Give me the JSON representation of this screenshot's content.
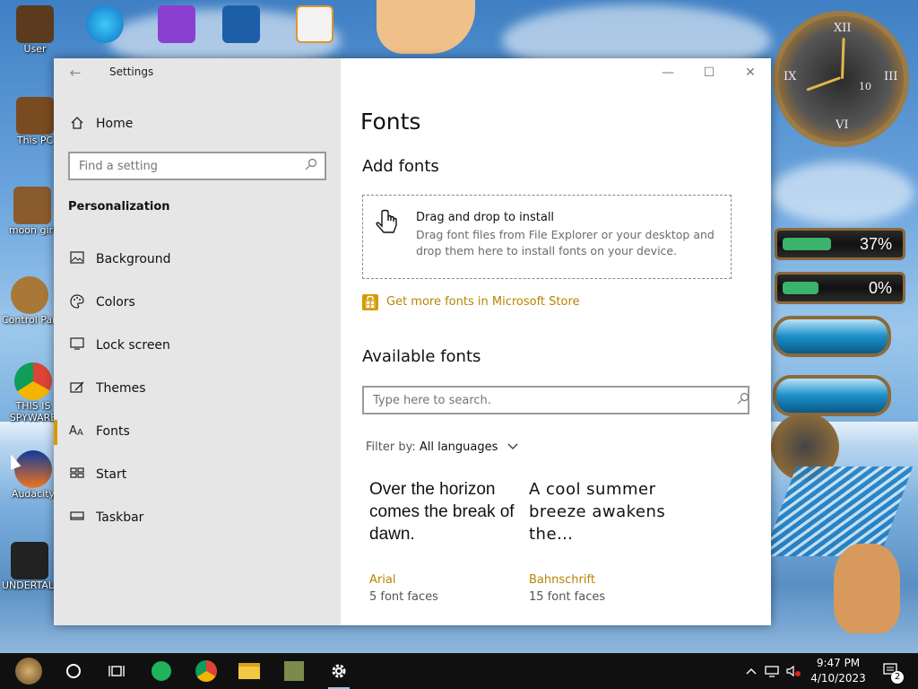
{
  "desktop": {
    "icons": [
      {
        "label": "User"
      },
      {
        "label": "This PC"
      },
      {
        "label": "moon girl"
      },
      {
        "label": "Control Panel"
      },
      {
        "label": "THIS IS"
      },
      {
        "label": "SPYWARE"
      },
      {
        "label": "Audacity"
      },
      {
        "label": "UNDERTALE"
      }
    ],
    "widgets": {
      "gauge_top": "37%",
      "gauge_bottom": "0%",
      "clock_numbers": [
        "XII",
        "III",
        "VI",
        "IX",
        "10"
      ]
    }
  },
  "window": {
    "title": "Settings",
    "back_icon": "back-arrow-icon",
    "minimize_glyph": "—",
    "maximize_glyph": "☐",
    "close_glyph": "✕"
  },
  "sidebar": {
    "home_label": "Home",
    "search_placeholder": "Find a setting",
    "section_title": "Personalization",
    "items": [
      {
        "label": "Background",
        "icon": "image-icon"
      },
      {
        "label": "Colors",
        "icon": "palette-icon"
      },
      {
        "label": "Lock screen",
        "icon": "monitor-icon"
      },
      {
        "label": "Themes",
        "icon": "brush-icon"
      },
      {
        "label": "Fonts",
        "icon": "font-icon"
      },
      {
        "label": "Start",
        "icon": "start-grid-icon"
      },
      {
        "label": "Taskbar",
        "icon": "taskbar-icon"
      }
    ],
    "active_item": "Fonts"
  },
  "main": {
    "page_title": "Fonts",
    "add_fonts_title": "Add fonts",
    "drop_title": "Drag and drop to install",
    "drop_description": "Drag font files from File Explorer or your desktop and drop them here to install fonts on your device.",
    "store_link": "Get more fonts in Microsoft Store",
    "available_title": "Available fonts",
    "font_search_placeholder": "Type here to search.",
    "filter_label": "Filter by:",
    "filter_value": "All languages",
    "fonts": [
      {
        "sample": "Over the horizon comes the break of dawn.",
        "name": "Arial",
        "faces": "5 font faces"
      },
      {
        "sample": "A cool summer breeze awakens the…",
        "name": "Bahnschrift",
        "faces": "15 font faces"
      }
    ]
  },
  "taskbar": {
    "time": "9:47 PM",
    "date": "4/10/2023",
    "notification_count": "2",
    "accent": "#9ac3ea"
  },
  "colors": {
    "accent_gold": "#d59a00",
    "link_gold": "#b88500",
    "sidebar_bg": "#e6e6e6"
  }
}
